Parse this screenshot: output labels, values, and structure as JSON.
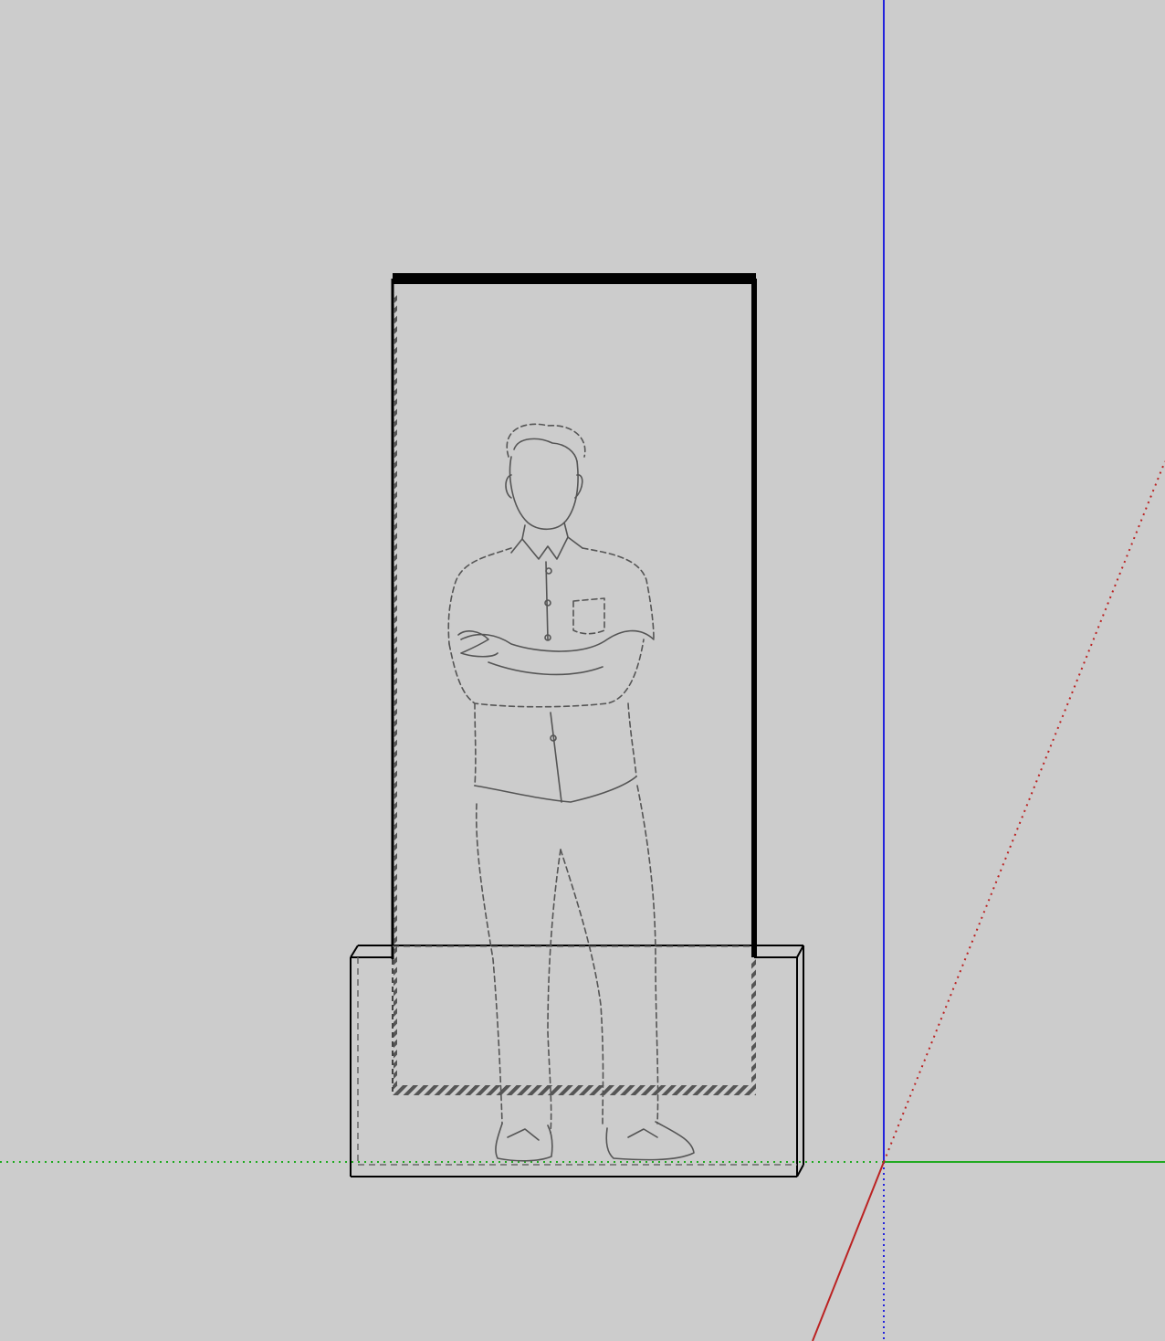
{
  "viewport": {
    "background_color": "#cccccc"
  },
  "axes": {
    "blue_axis_color": "#2222dd",
    "green_axis_color": "#22aa22",
    "red_axis_color": "#bb2222"
  },
  "model": {
    "edge_color": "#000000",
    "hidden_edge_color": "#555555",
    "objects": [
      "upright-panel",
      "base-block",
      "human-scale-figure"
    ]
  }
}
